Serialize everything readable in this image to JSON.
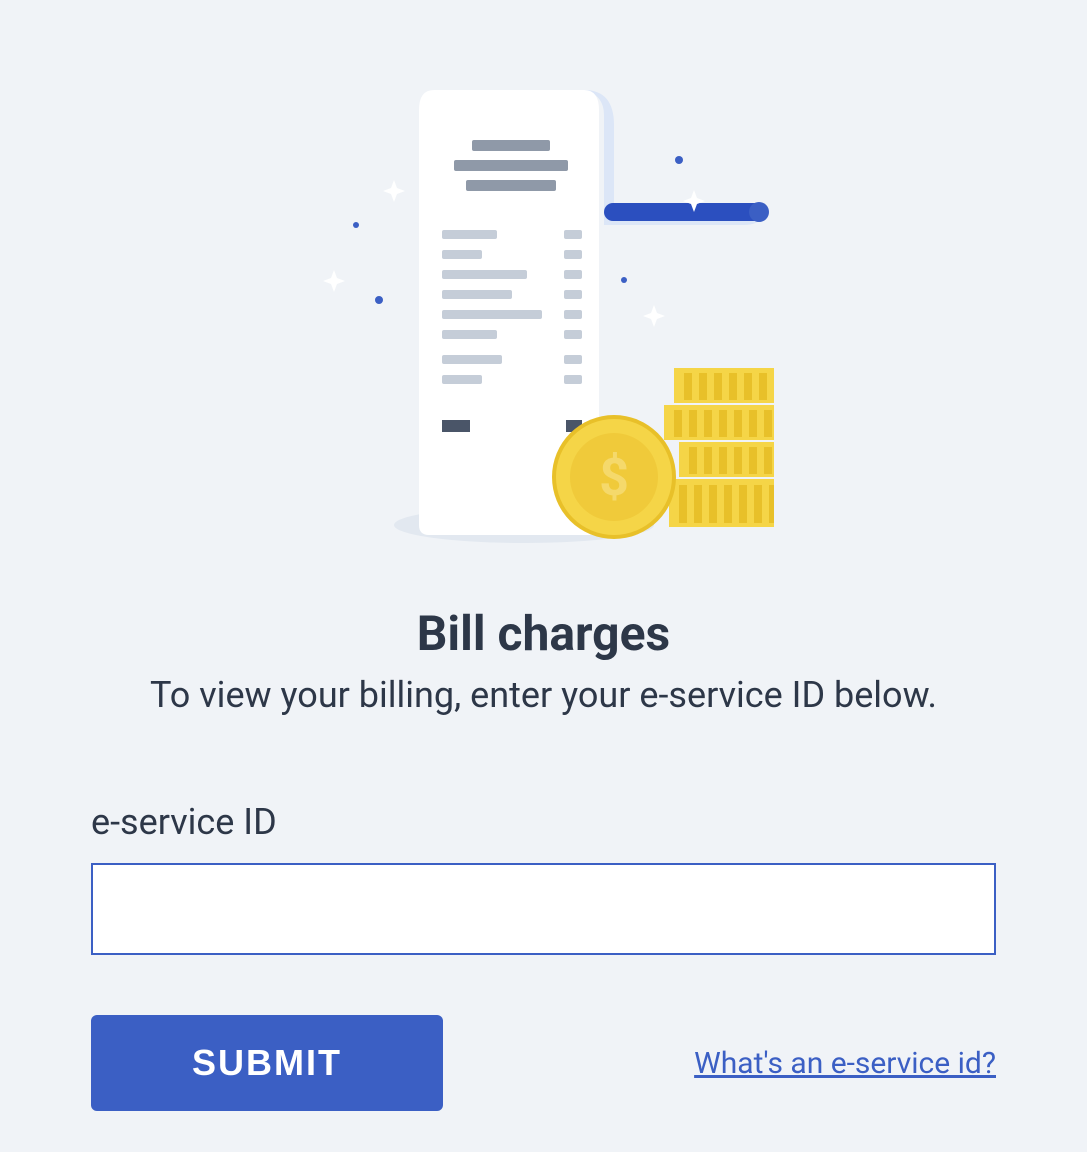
{
  "heading": "Bill charges",
  "subheading": "To view your billing, enter your e-service ID below.",
  "form": {
    "label": "e-service ID",
    "value": "",
    "submit_label": "SUBMIT"
  },
  "help_link": "What's an e-service id?"
}
